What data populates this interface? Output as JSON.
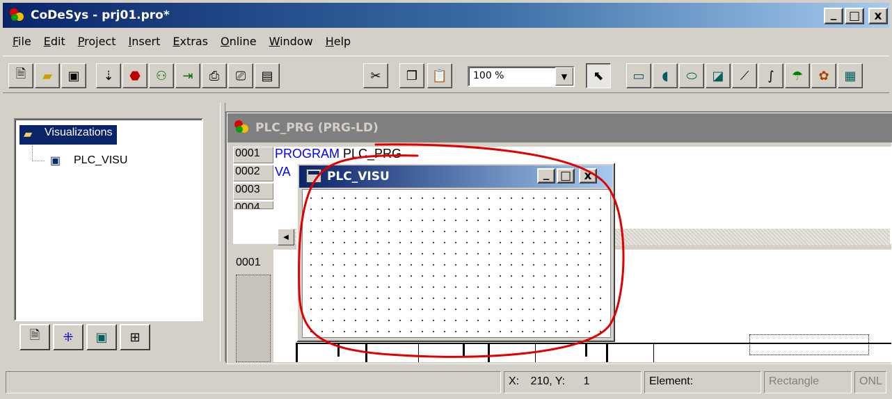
{
  "window": {
    "title": "CoDeSys - prj01.pro*",
    "controls": {
      "minimize": "_",
      "maximize": "□",
      "close": "x"
    }
  },
  "menu": [
    "File",
    "Edit",
    "Project",
    "Insert",
    "Extras",
    "Online",
    "Window",
    "Help"
  ],
  "toolbar": {
    "zoom_value": "100 %",
    "buttons": [
      "new-icon",
      "open-icon",
      "save-icon",
      "build-icon",
      "stop-icon",
      "login-icon",
      "step-icon",
      "print-icon",
      "print-delete-icon",
      "copy-project-icon",
      "cut-icon",
      "copy-icon",
      "paste-icon",
      "select-icon",
      "rectangle-icon",
      "rounded-rectangle-icon",
      "ellipse-icon",
      "polygon-icon",
      "polyline-icon",
      "curve-icon",
      "bitmap-icon",
      "palette-icon",
      "visualization-icon"
    ]
  },
  "object_tree": {
    "root_label": "Visualizations",
    "child_label": "PLC_VISU",
    "tabs": [
      "pou-tab-icon",
      "datatype-tab-icon",
      "visualization-tab-icon",
      "resources-tab-icon"
    ]
  },
  "prg_window": {
    "title": "PLC_PRG (PRG-LD)",
    "lines": [
      {
        "num": "0001",
        "code_kw": "PROGRAM",
        "code_rest": " PLC_PRG"
      },
      {
        "num": "0002",
        "code_kw": "VA",
        "code_rest": ""
      },
      {
        "num": "0003",
        "code_kw": "",
        "code_rest": ""
      },
      {
        "num": "0004",
        "code_kw": "",
        "code_rest": ""
      }
    ],
    "ld_network_number": "0001"
  },
  "visu_window": {
    "title": "PLC_VISU"
  },
  "status": {
    "message": "",
    "x_label": "X:",
    "x_value": "210",
    "y_label": "Y:",
    "y_value": "1",
    "element_label": "Element:",
    "element_value": "Rectangle",
    "online_flag": "ONL"
  },
  "annotation": {
    "color": "#e00000"
  }
}
